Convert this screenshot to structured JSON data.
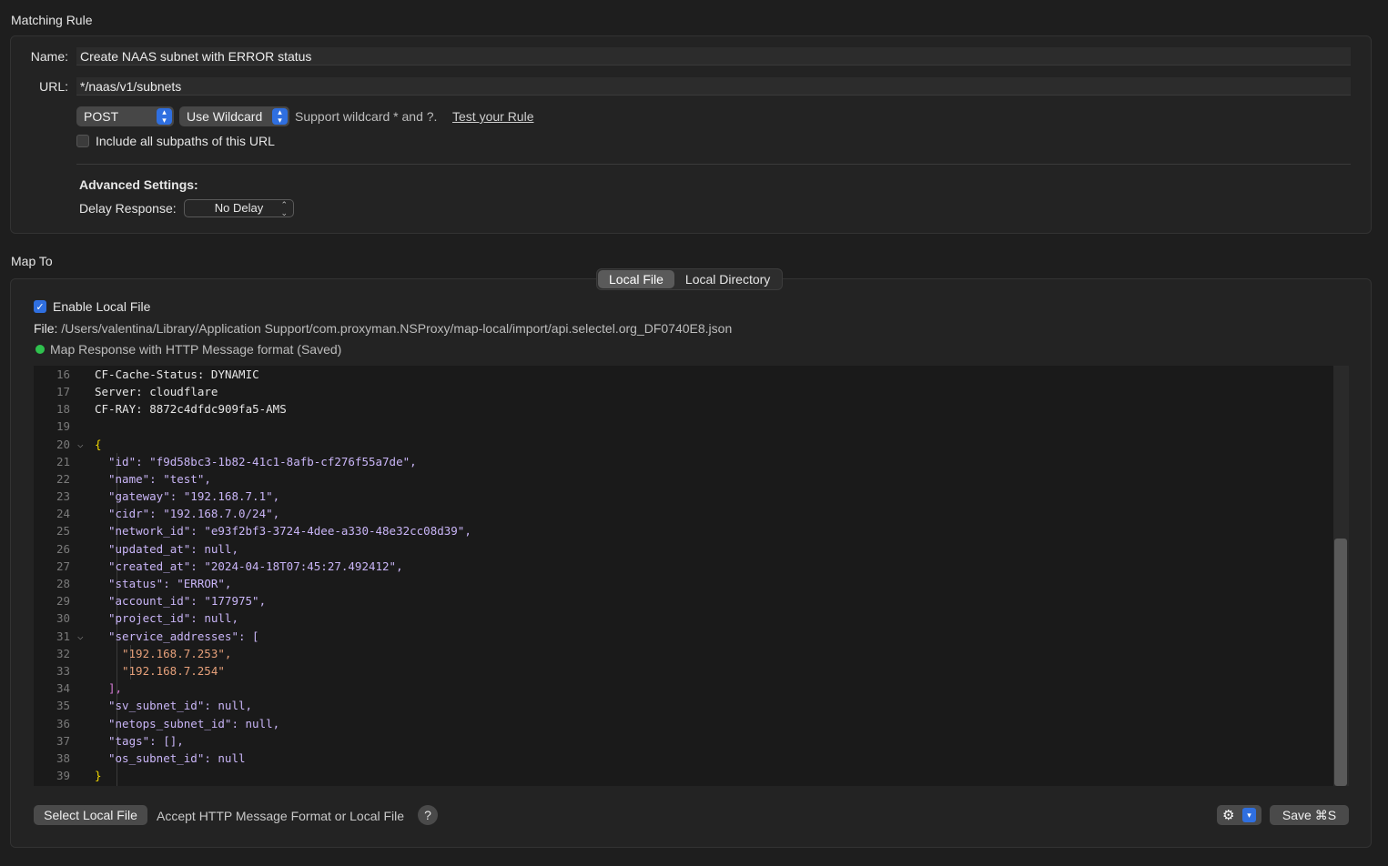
{
  "matching_rule": {
    "section_title": "Matching Rule",
    "name_label": "Name:",
    "name_value": "Create NAAS subnet with ERROR status",
    "url_label": "URL:",
    "url_value": "*/naas/v1/subnets",
    "method": "POST",
    "match_type": "Use Wildcard",
    "wildcard_hint": "Support wildcard * and ?.",
    "test_link": "Test your Rule",
    "include_subpaths_label": "Include all subpaths of this URL",
    "include_subpaths_checked": false,
    "advanced_title": "Advanced Settings:",
    "delay_label": "Delay Response:",
    "delay_value": "No Delay"
  },
  "map_to": {
    "section_title": "Map To",
    "tabs": [
      "Local File",
      "Local Directory"
    ],
    "active_tab": "Local File",
    "enable_label": "Enable Local File",
    "enable_checked": true,
    "file_label": "File:",
    "file_path": "/Users/valentina/Library/Application Support/com.proxyman.NSProxy/map-local/import/api.selectel.org_DF0740E8.json",
    "status_text": "Map Response with HTTP Message format (Saved)",
    "status_color": "#2fc14e",
    "select_button": "Select Local File",
    "accept_hint": "Accept HTTP Message Format or Local File",
    "help_glyph": "?",
    "save_button": "Save ⌘S"
  },
  "editor": {
    "lines": [
      {
        "n": "16",
        "text": "CF-Cache-Status: DYNAMIC"
      },
      {
        "n": "17",
        "text": "Server: cloudflare"
      },
      {
        "n": "18",
        "text": "CF-RAY: 8872c4dfdc909fa5-AMS"
      },
      {
        "n": "19",
        "text": ""
      },
      {
        "n": "20",
        "text": "{"
      },
      {
        "n": "21",
        "text": "\"id\": \"f9d58bc3-1b82-41c1-8afb-cf276f55a7de\","
      },
      {
        "n": "22",
        "text": "\"name\": \"test\","
      },
      {
        "n": "23",
        "text": "\"gateway\": \"192.168.7.1\","
      },
      {
        "n": "24",
        "text": "\"cidr\": \"192.168.7.0/24\","
      },
      {
        "n": "25",
        "text": "\"network_id\": \"e93f2bf3-3724-4dee-a330-48e32cc08d39\","
      },
      {
        "n": "26",
        "text": "\"updated_at\": null,"
      },
      {
        "n": "27",
        "text": "\"created_at\": \"2024-04-18T07:45:27.492412\","
      },
      {
        "n": "28",
        "text": "\"status\": \"ERROR\","
      },
      {
        "n": "29",
        "text": "\"account_id\": \"177975\","
      },
      {
        "n": "30",
        "text": "\"project_id\": null,"
      },
      {
        "n": "31",
        "text": "\"service_addresses\": ["
      },
      {
        "n": "32",
        "text": "\"192.168.7.253\","
      },
      {
        "n": "33",
        "text": "\"192.168.7.254\""
      },
      {
        "n": "34",
        "text": "],"
      },
      {
        "n": "35",
        "text": "\"sv_subnet_id\": null,"
      },
      {
        "n": "36",
        "text": "\"netops_subnet_id\": null,"
      },
      {
        "n": "37",
        "text": "\"tags\": [],"
      },
      {
        "n": "38",
        "text": "\"os_subnet_id\": null"
      },
      {
        "n": "39",
        "text": "}"
      }
    ],
    "scroll_position": 0.38
  }
}
